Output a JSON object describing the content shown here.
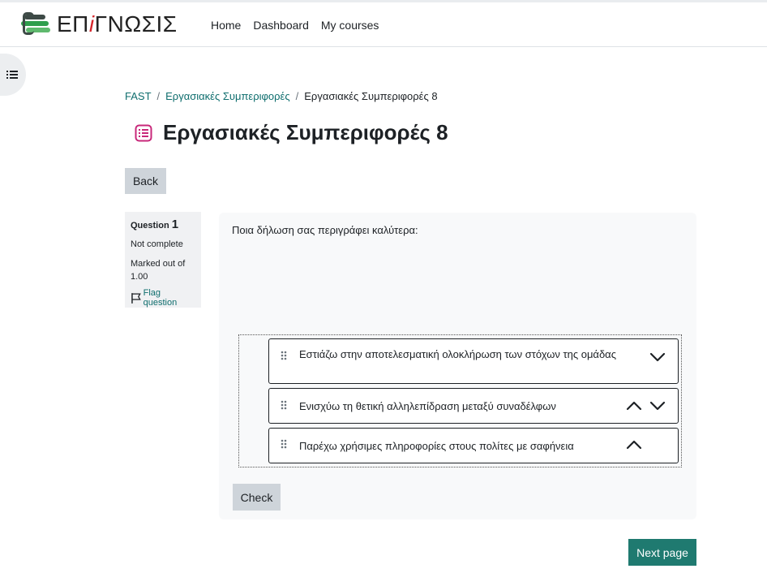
{
  "header": {
    "logo_text_before": "ΕΠ",
    "logo_text_accent": "i",
    "logo_text_after": "ΓΝΩΣΙΣ",
    "nav": [
      "Home",
      "Dashboard",
      "My courses"
    ]
  },
  "breadcrumb": {
    "items": [
      "FAST",
      "Εργασιακές Συμπεριφορές",
      "Εργασιακές Συμπεριφορές 8"
    ],
    "separator": "/"
  },
  "page": {
    "title": "Εργασιακές Συμπεριφορές 8",
    "back_label": "Back"
  },
  "question_info": {
    "label": "Question",
    "number": "1",
    "state": "Not complete",
    "marks": "Marked out of 1.00",
    "flag_label": "Flag question"
  },
  "question": {
    "text": "Ποια δήλωση σας περιγράφει καλύτερα:",
    "items": [
      {
        "label": "Εστιάζω στην αποτελεσματική ολοκλήρωση των στόχων της ομάδας",
        "can_move_up": false,
        "can_move_down": true
      },
      {
        "label": "Ενισχύω τη θετική αλληλεπίδραση μεταξύ συναδέλφων",
        "can_move_up": true,
        "can_move_down": true
      },
      {
        "label": "Παρέχω χρήσιμες πληροφορίες στους πολίτες με σαφήνεια",
        "can_move_up": true,
        "can_move_down": false
      }
    ],
    "check_label": "Check"
  },
  "footer": {
    "next_label": "Next page"
  },
  "colors": {
    "link": "#0f6e6e",
    "primary": "#1f7a70",
    "secondary_button": "#ced4da",
    "quiz_icon": "#c8287a"
  }
}
